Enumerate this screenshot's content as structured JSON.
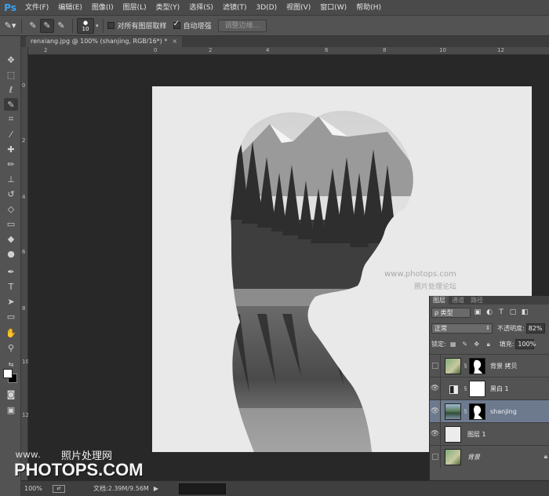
{
  "app": {
    "logo": "Ps"
  },
  "menu": [
    "文件(F)",
    "编辑(E)",
    "图像(I)",
    "图层(L)",
    "类型(Y)",
    "选择(S)",
    "滤镜(T)",
    "3D(D)",
    "视图(V)",
    "窗口(W)",
    "帮助(H)"
  ],
  "options": {
    "brush_size": "10",
    "sample_all_layers_label": "对所有图层取样",
    "sample_all_layers_checked": false,
    "auto_enhance_label": "自动增强",
    "auto_enhance_checked": true,
    "refine_edge_label": "调整边缘..."
  },
  "document": {
    "tab_title": "renxiang.jpg @ 100% (shanjing, RGB/16*) *",
    "close_glyph": "×"
  },
  "ruler": {
    "top_labels": [
      "2",
      "0",
      "2",
      "4",
      "6",
      "8",
      "10",
      "12"
    ],
    "left_labels": [
      "0",
      "2",
      "4",
      "6",
      "8",
      "10",
      "12",
      "14"
    ]
  },
  "watermark": {
    "site_small": "www.photops.com",
    "cn_small": "照片处理论坛",
    "www": "www.",
    "cn_big": "照片处理网",
    "brand": "PHOTOPS.COM"
  },
  "status": {
    "zoom": "100%",
    "doc_info": "文档:2.39M/9.56M",
    "arrow": "▶"
  },
  "layers_panel": {
    "tabs": [
      "图层",
      "通道",
      "路径"
    ],
    "filter_label": "ρ 类型",
    "blend_mode": "正常",
    "opacity_label": "不透明度:",
    "opacity_value": "82%",
    "lock_label": "锁定:",
    "fill_label": "填充:",
    "fill_value": "100%",
    "layers": [
      {
        "name": "背景 拷贝",
        "visible": false,
        "has_mask": true,
        "thumb": "photo",
        "selected": false
      },
      {
        "name": "黑白 1",
        "visible": true,
        "has_mask": true,
        "thumb": "adjustment",
        "selected": false
      },
      {
        "name": "shanjing",
        "visible": true,
        "has_mask": true,
        "thumb": "landscape",
        "selected": true
      },
      {
        "name": "图层 1",
        "visible": true,
        "has_mask": false,
        "thumb": "blank",
        "selected": false
      },
      {
        "name": "背景",
        "visible": false,
        "has_mask": false,
        "thumb": "photo",
        "selected": false,
        "locked": true
      }
    ]
  },
  "colors": {
    "accent": "#38a4f2",
    "selected_layer": "#6d7a8e",
    "panel_bg": "#535353",
    "canvas_bg": "#e9e9e9"
  }
}
